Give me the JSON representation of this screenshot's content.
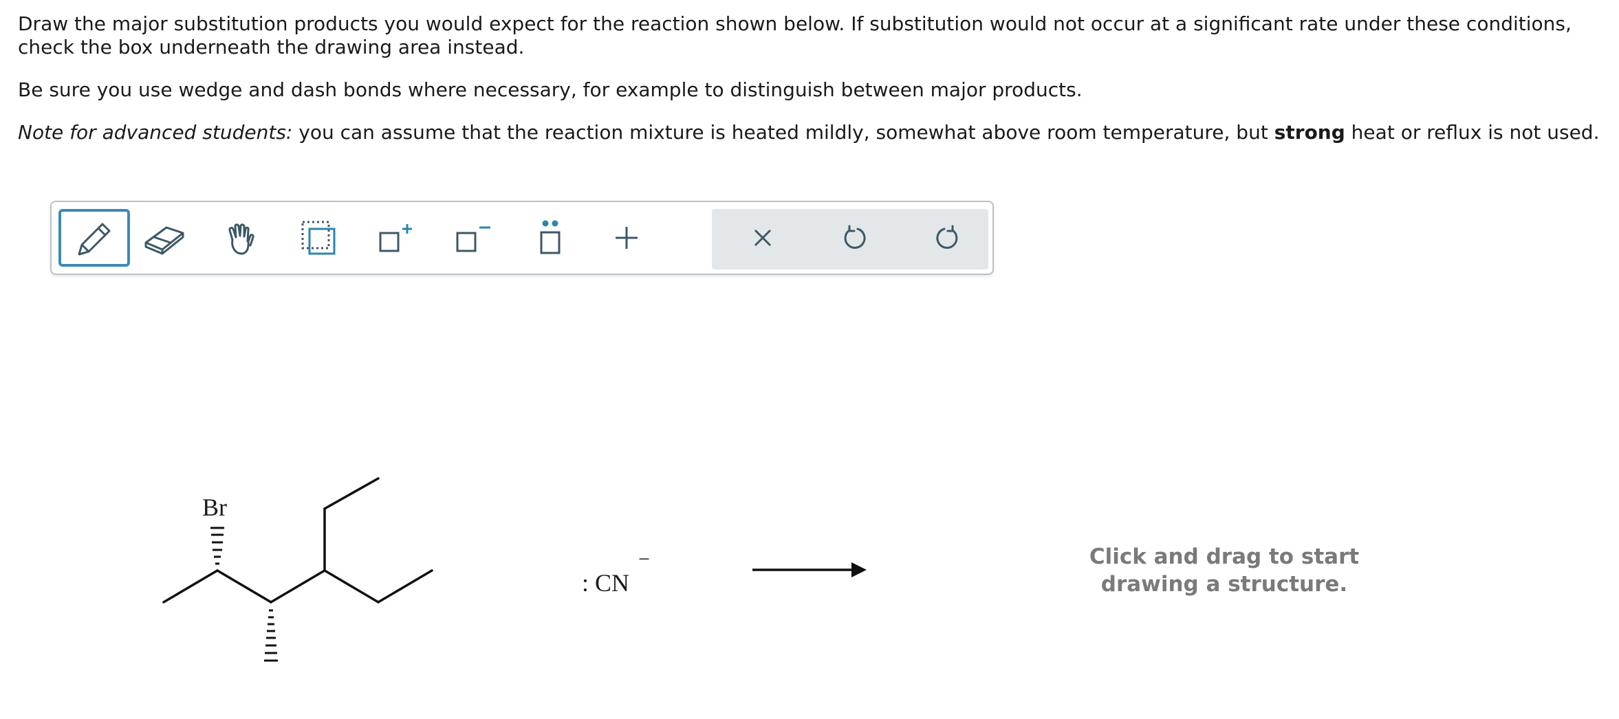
{
  "instructions": {
    "p1": "Draw the major substitution products you would expect for the reaction shown below. If substitution would not occur at a significant rate under these conditions, check the box underneath the drawing area instead.",
    "p2": "Be sure you use wedge and dash bonds where necessary, for example to distinguish between major products.",
    "p3_italic": "Note for advanced students:",
    "p3_a": " you can assume that the reaction mixture is heated mildly, somewhat above room temperature, but ",
    "p3_bold": "strong",
    "p3_b": " heat or reflux is not used."
  },
  "toolbar": {
    "tools": [
      {
        "name": "pencil-tool",
        "icon": "pencil-icon",
        "active": true
      },
      {
        "name": "eraser-tool",
        "icon": "eraser-icon"
      },
      {
        "name": "hand-tool",
        "icon": "hand-icon"
      },
      {
        "name": "select-tool",
        "icon": "selection-box-icon"
      },
      {
        "name": "add-positive-charge-tool",
        "icon": "positive-charge-icon"
      },
      {
        "name": "add-negative-charge-tool",
        "icon": "negative-charge-icon"
      },
      {
        "name": "add-lone-pair-tool",
        "icon": "lone-pair-icon"
      },
      {
        "name": "add-arrow-tool",
        "icon": "plus-icon"
      },
      {
        "name": "clear-button",
        "icon": "close-icon"
      },
      {
        "name": "undo-button",
        "icon": "undo-icon"
      },
      {
        "name": "redo-button",
        "icon": "redo-icon"
      }
    ],
    "accent_color": "#3a8ab8",
    "icon_color": "#3d5866"
  },
  "reaction": {
    "reactant_label": "Br",
    "reagent_label": ": CN",
    "reagent_charge": "−"
  },
  "canvas": {
    "hint_line1": "Click and drag to start",
    "hint_line2": "drawing a structure."
  }
}
